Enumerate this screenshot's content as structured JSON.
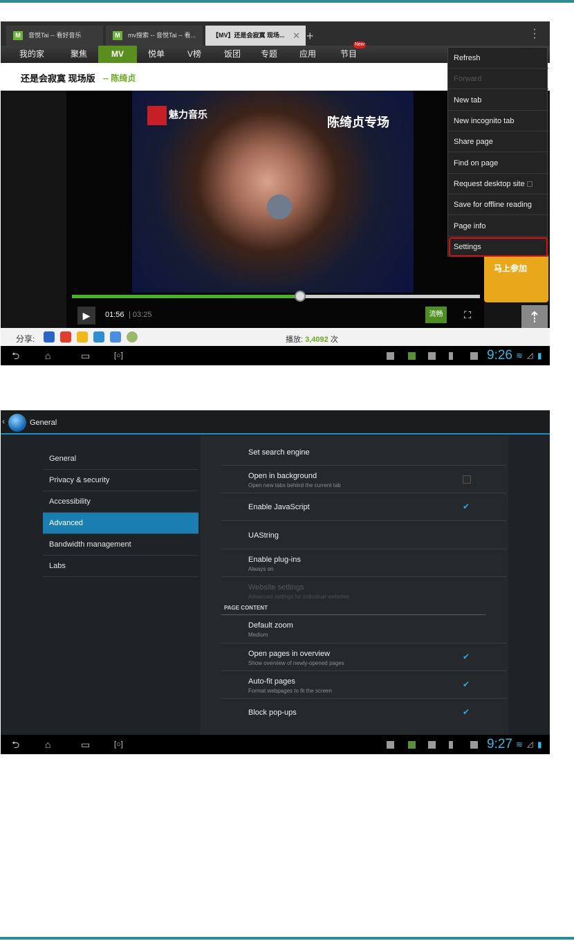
{
  "top_screenshot": {
    "tabs": [
      {
        "label": "音悦Tai -- 看好音乐",
        "favicon": "M"
      },
      {
        "label": "mv搜索 -- 音悦Tai -- 看...",
        "favicon": "M"
      },
      {
        "label": "【MV】还是会寂寞 现场...",
        "active": true
      }
    ],
    "new_tab_symbol": "+",
    "close_symbol": "✕",
    "site_nav": [
      "我的家",
      "聚焦",
      "MV",
      "悦单",
      "V榜",
      "饭团",
      "专题",
      "应用",
      "节目"
    ],
    "site_nav_active": "MV",
    "nav_badge": "New",
    "song_title": "还是会寂寞 现场版",
    "artist_separator": "--",
    "artist": "陈绮贞",
    "video": {
      "station_logo_text": "魅力音乐",
      "overlay_title": "陈绮贞专场",
      "current_time": "01:56",
      "total_time": "03:25",
      "progress": 0.56,
      "quality_label": "流畅"
    },
    "promo_text": "马上参加",
    "share_label": "分享:",
    "plays_label": "播放:",
    "plays_value": "3,4092",
    "plays_suffix": "次",
    "menu_items": [
      {
        "label": "Refresh",
        "enabled": true
      },
      {
        "label": "Forward",
        "enabled": false
      },
      {
        "label": "New tab",
        "enabled": true
      },
      {
        "label": "New incognito tab",
        "enabled": true
      },
      {
        "label": "Share page",
        "enabled": true
      },
      {
        "label": "Find on page",
        "enabled": true
      },
      {
        "label": "Request desktop site",
        "enabled": true
      },
      {
        "label": "Save for offline reading",
        "enabled": true
      },
      {
        "label": "Page info",
        "enabled": true
      },
      {
        "label": "Settings",
        "enabled": true,
        "highlighted": true
      }
    ],
    "clock": "9:26"
  },
  "bottom_screenshot": {
    "title": "General",
    "categories": [
      "General",
      "Privacy & security",
      "Accessibility",
      "Advanced",
      "Bandwidth management",
      "Labs"
    ],
    "selected_category": "Advanced",
    "settings": [
      {
        "title": "Set search engine",
        "subtitle": ""
      },
      {
        "title": "Open in background",
        "subtitle": "Open new tabs behind the current tab",
        "checkbox": false
      },
      {
        "title": "Enable JavaScript",
        "subtitle": "",
        "checkbox": true
      },
      {
        "title": "UAString",
        "subtitle": ""
      },
      {
        "title": "Enable plug-ins",
        "subtitle": "Always on"
      },
      {
        "title": "Website settings",
        "subtitle": "Advanced settings for individual websites",
        "disabled": true
      }
    ],
    "section_header": "PAGE CONTENT",
    "page_content_settings": [
      {
        "title": "Default zoom",
        "subtitle": "Medium"
      },
      {
        "title": "Open pages in overview",
        "subtitle": "Show overview of newly-opened pages",
        "checkbox": true
      },
      {
        "title": "Auto-fit pages",
        "subtitle": "Format webpages to fit the screen",
        "checkbox": true
      },
      {
        "title": "Block pop-ups",
        "subtitle": "",
        "checkbox": true
      }
    ],
    "clock": "9:27"
  },
  "icons": {
    "nav_back": "back-icon",
    "nav_home": "home-icon",
    "nav_recents": "recents-icon",
    "nav_screenshot": "screenshot-icon",
    "checkmark": "✔",
    "play": "▶",
    "to_top": "⇡"
  },
  "colors": {
    "accent_blue": "#1a7fb0",
    "clock_blue": "#39b6e6",
    "site_green": "#5a8f1f",
    "progress_green": "#4caf2e",
    "highlight_red": "#d11111",
    "page_rule": "#2f8b93"
  }
}
